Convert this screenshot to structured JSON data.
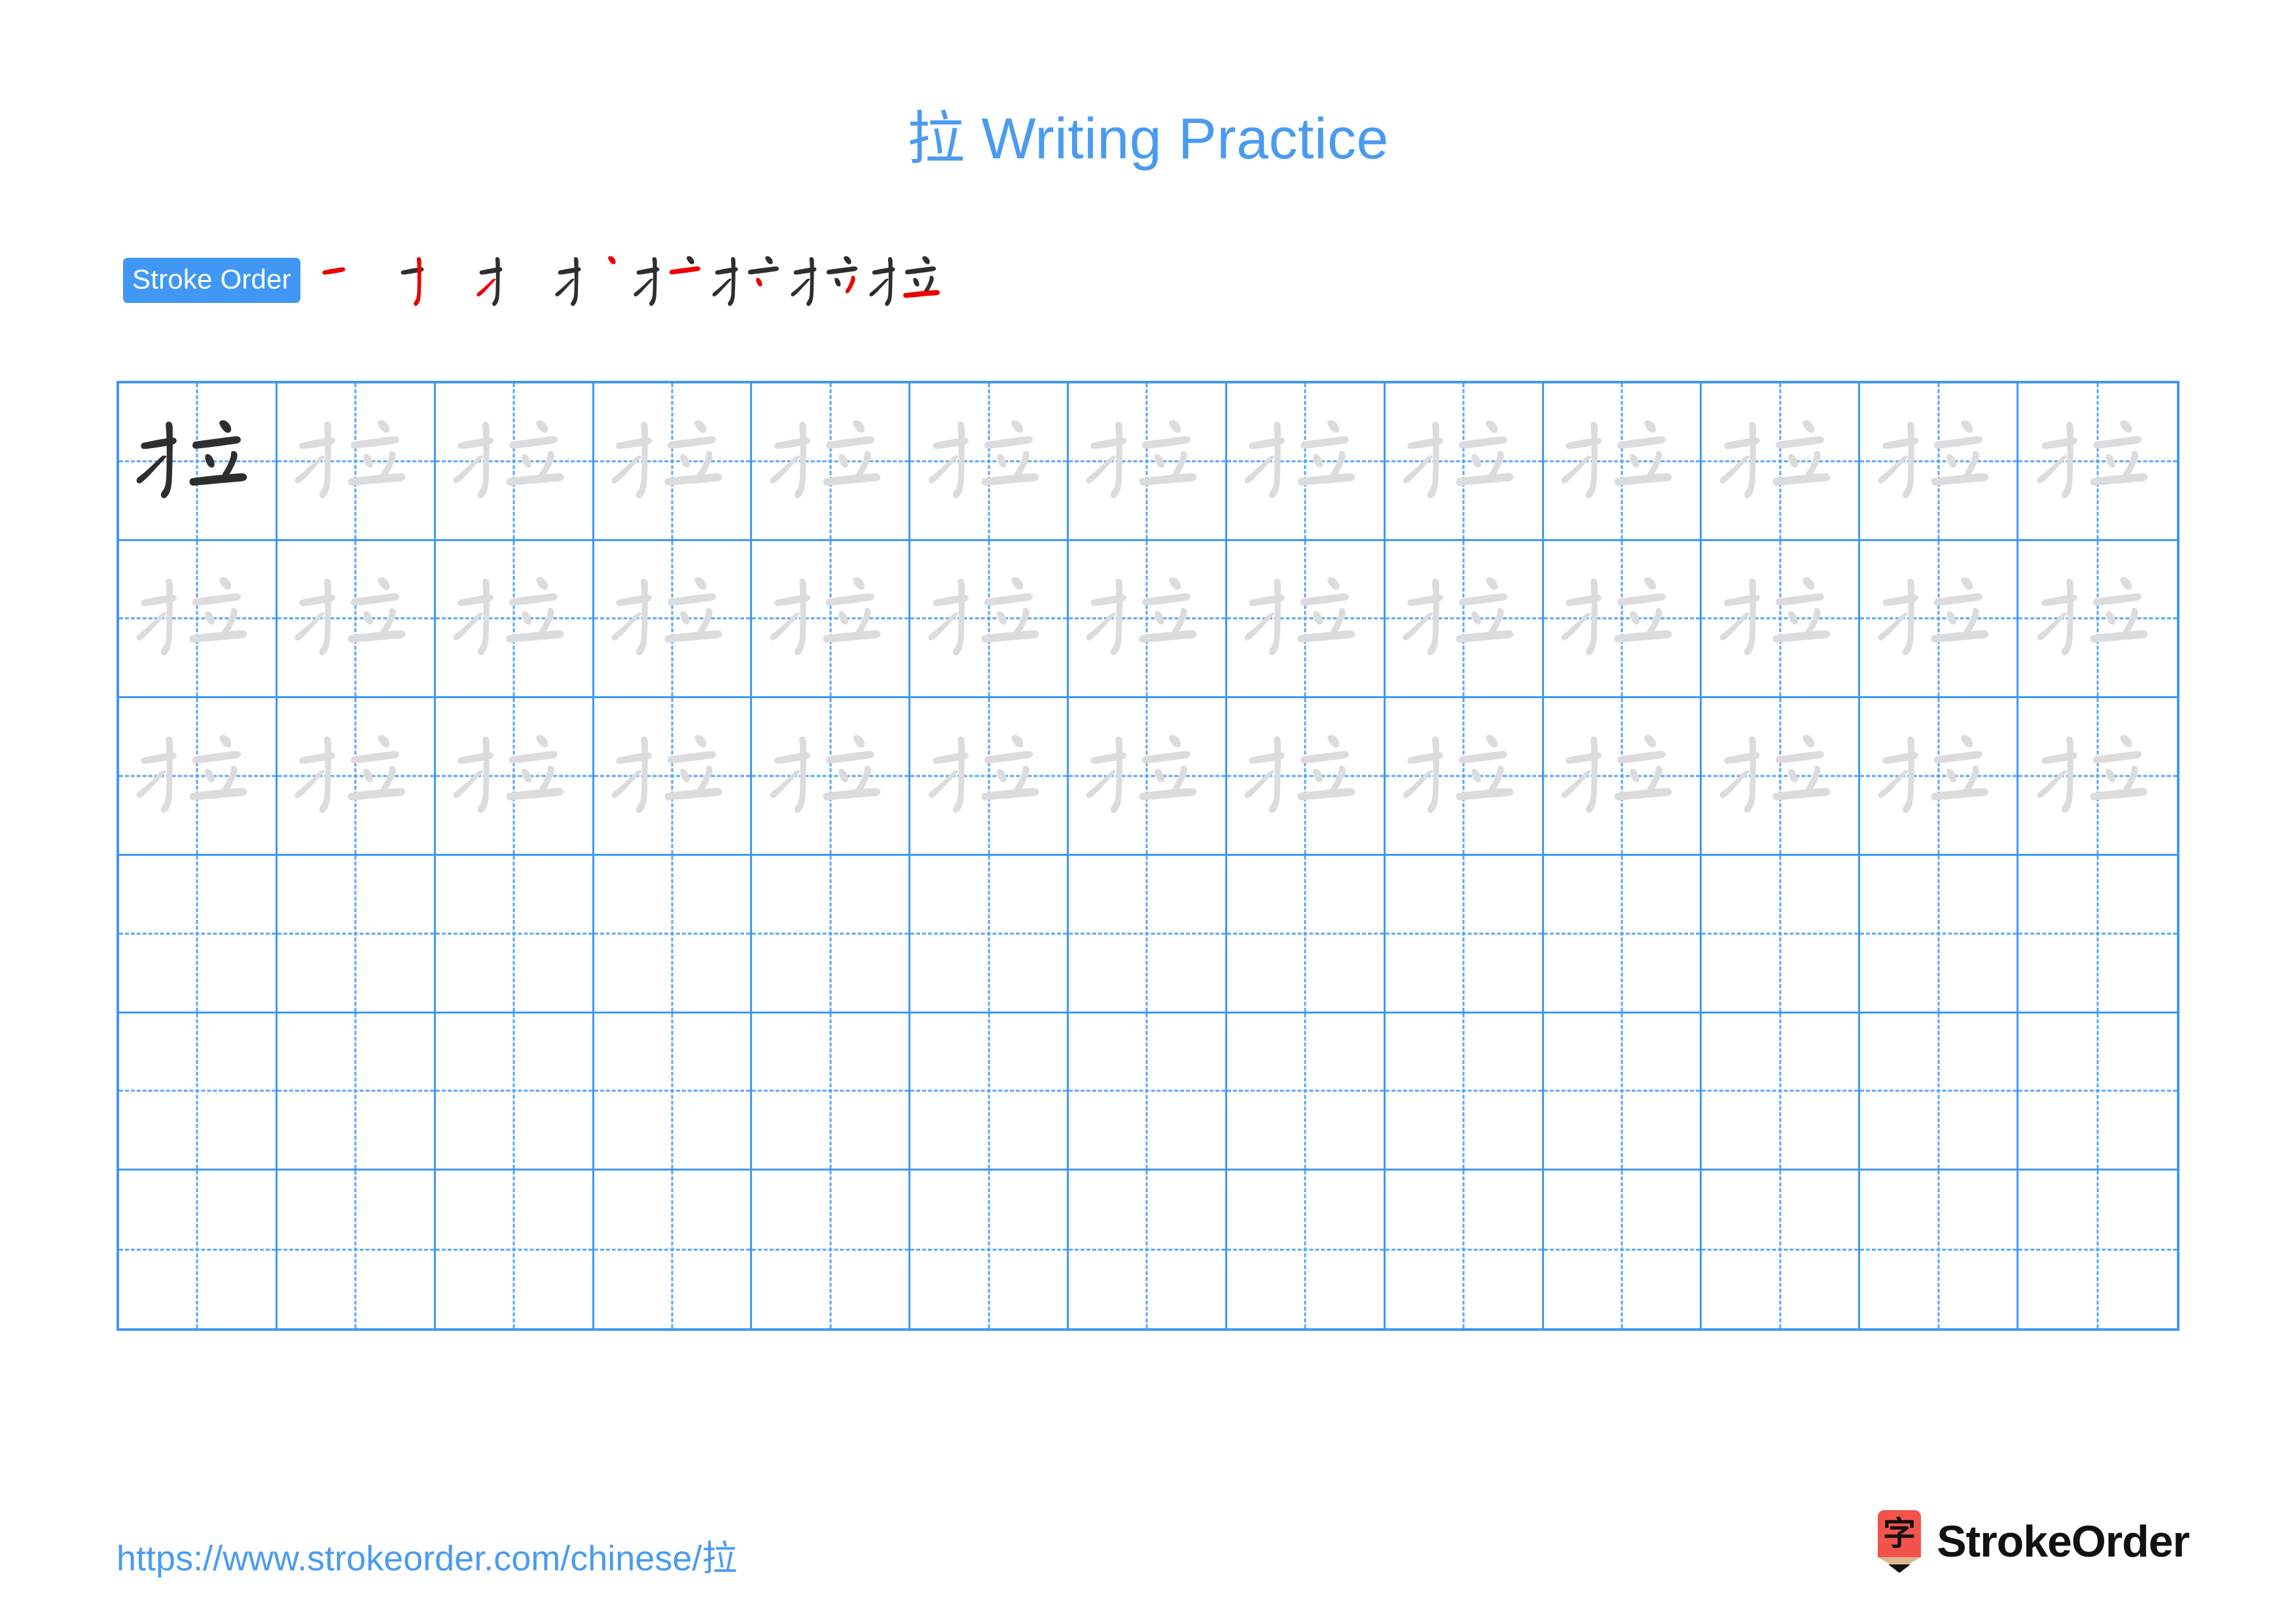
{
  "header": {
    "character": "拉",
    "title_suffix": " Writing Practice",
    "title_full": "拉 Writing Practice",
    "title_color": "#4a9bf0"
  },
  "stroke_order": {
    "badge_label": "Stroke Order",
    "badge_bg": "#4098f4",
    "badge_text_color": "#ffffff",
    "new_stroke_color": "#ee0000",
    "old_stroke_color": "#2e2e2e",
    "total_strokes": 8,
    "steps": [
      {
        "step": 1,
        "strokes_shown": 1,
        "new_stroke_index": 1
      },
      {
        "step": 2,
        "strokes_shown": 2,
        "new_stroke_index": 2
      },
      {
        "step": 3,
        "strokes_shown": 3,
        "new_stroke_index": 3
      },
      {
        "step": 4,
        "strokes_shown": 4,
        "new_stroke_index": 4
      },
      {
        "step": 5,
        "strokes_shown": 5,
        "new_stroke_index": 5
      },
      {
        "step": 6,
        "strokes_shown": 6,
        "new_stroke_index": 6
      },
      {
        "step": 7,
        "strokes_shown": 7,
        "new_stroke_index": 7
      },
      {
        "step": 8,
        "strokes_shown": 8,
        "new_stroke_index": 8
      }
    ]
  },
  "grid": {
    "columns": 13,
    "rows": 6,
    "border_color": "#4098f4",
    "guide_color": "#5aa7f5",
    "dark_char_color": "#2e2e2e",
    "trace_char_color": "#dcdcdc",
    "cells": [
      [
        "dark",
        "trace",
        "trace",
        "trace",
        "trace",
        "trace",
        "trace",
        "trace",
        "trace",
        "trace",
        "trace",
        "trace",
        "trace"
      ],
      [
        "trace",
        "trace",
        "trace",
        "trace",
        "trace",
        "trace",
        "trace",
        "trace",
        "trace",
        "trace",
        "trace",
        "trace",
        "trace"
      ],
      [
        "trace",
        "trace",
        "trace",
        "trace",
        "trace",
        "trace",
        "trace",
        "trace",
        "trace",
        "trace",
        "trace",
        "trace",
        "trace"
      ],
      [
        "empty",
        "empty",
        "empty",
        "empty",
        "empty",
        "empty",
        "empty",
        "empty",
        "empty",
        "empty",
        "empty",
        "empty",
        "empty"
      ],
      [
        "empty",
        "empty",
        "empty",
        "empty",
        "empty",
        "empty",
        "empty",
        "empty",
        "empty",
        "empty",
        "empty",
        "empty",
        "empty"
      ],
      [
        "empty",
        "empty",
        "empty",
        "empty",
        "empty",
        "empty",
        "empty",
        "empty",
        "empty",
        "empty",
        "empty",
        "empty",
        "empty"
      ]
    ]
  },
  "footer": {
    "url": "https://www.strokeorder.com/chinese/拉",
    "url_color": "#4a9bf0",
    "logo_text": "StrokeOrder",
    "logo_icon_char": "字",
    "logo_body_color": "#f2544c",
    "logo_wood_color": "#dbb893",
    "logo_tip_color": "#111111"
  }
}
